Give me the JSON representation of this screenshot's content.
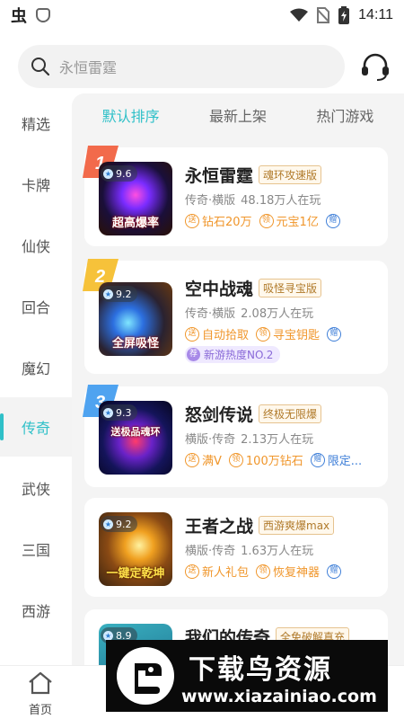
{
  "status_bar": {
    "time": "14:11",
    "app_glyph": "虫"
  },
  "search": {
    "placeholder": "永恒雷霆"
  },
  "sidebar": {
    "items": [
      {
        "label": "精选"
      },
      {
        "label": "卡牌"
      },
      {
        "label": "仙侠"
      },
      {
        "label": "回合"
      },
      {
        "label": "魔幻"
      },
      {
        "label": "传奇",
        "active": true
      },
      {
        "label": "武侠"
      },
      {
        "label": "三国"
      },
      {
        "label": "西游"
      }
    ]
  },
  "tabs": [
    {
      "label": "默认排序",
      "active": true
    },
    {
      "label": "最新上架"
    },
    {
      "label": "热门游戏"
    }
  ],
  "games": [
    {
      "rank": "1",
      "score": "9.6",
      "thumb_label": "超高爆率",
      "name": "永恒雷霆",
      "tag": "魂环攻速版",
      "genre": "传奇·横版",
      "players": "48.18万人在玩",
      "perks": [
        {
          "icon": "送",
          "text": "钻石20万",
          "color": "orange"
        },
        {
          "icon": "领",
          "text": "元宝1亿",
          "color": "orange"
        },
        {
          "icon": "赠",
          "text": "",
          "color": "blue"
        }
      ]
    },
    {
      "rank": "2",
      "score": "9.2",
      "thumb_label": "全屏吸怪",
      "name": "空中战魂",
      "tag": "吸怪寻宝版",
      "genre": "传奇·横版",
      "players": "2.08万人在玩",
      "perks": [
        {
          "icon": "送",
          "text": "自动拾取",
          "color": "orange"
        },
        {
          "icon": "领",
          "text": "寻宝钥匙",
          "color": "orange"
        },
        {
          "icon": "赠",
          "text": "",
          "color": "blue"
        }
      ],
      "hot": {
        "icon": "荐",
        "text": "新游热度NO.2"
      }
    },
    {
      "rank": "3",
      "score": "9.3",
      "thumb_label": "送极品魂环",
      "name": "怒剑传说",
      "tag": "终极无限爆",
      "genre": "横版·传奇",
      "players": "2.13万人在玩",
      "perks": [
        {
          "icon": "送",
          "text": "满V",
          "color": "orange"
        },
        {
          "icon": "领",
          "text": "100万钻石",
          "color": "orange"
        },
        {
          "icon": "赠",
          "text": "限定...",
          "color": "blue"
        }
      ]
    },
    {
      "rank": "",
      "score": "9.2",
      "thumb_label": "一键定乾坤",
      "name": "王者之战",
      "tag": "西游爽爆max",
      "genre": "横版·传奇",
      "players": "1.63万人在玩",
      "perks": [
        {
          "icon": "送",
          "text": "新人礼包",
          "color": "orange"
        },
        {
          "icon": "领",
          "text": "恢复神器",
          "color": "orange"
        },
        {
          "icon": "赠",
          "text": "",
          "color": "blue"
        }
      ]
    },
    {
      "rank": "",
      "score": "8.9",
      "thumb_label": "",
      "name": "我们的传奇",
      "tag": "全免破解真充",
      "genre": "",
      "players": "",
      "perks": []
    }
  ],
  "bottom_nav": {
    "home_label": "首页"
  },
  "watermark": {
    "title": "下载鸟资源",
    "url": "www.xiazainiao.com"
  },
  "colors": {
    "accent": "#2fc0c8",
    "perk_orange": "#f0962b",
    "perk_blue": "#3f7fd8"
  }
}
